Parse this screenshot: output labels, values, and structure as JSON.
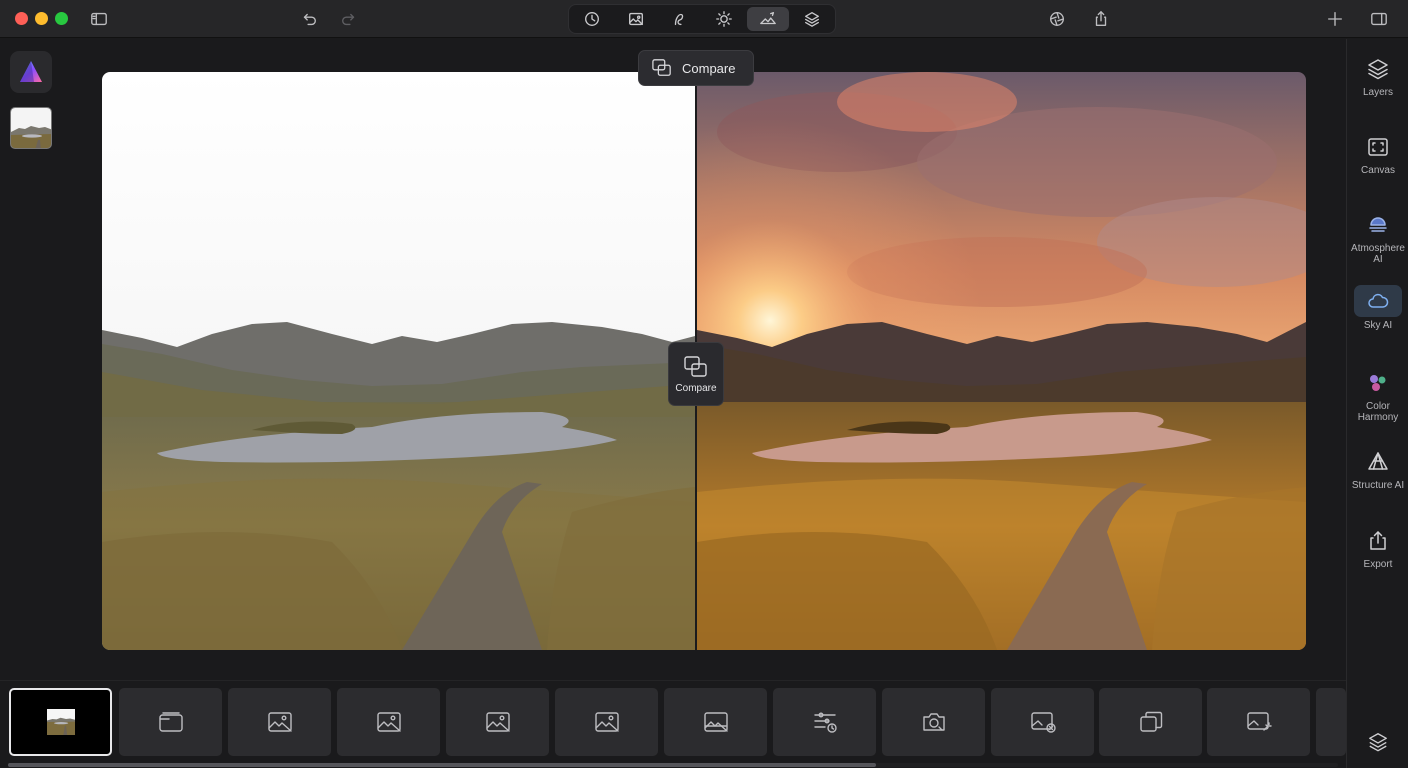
{
  "app": {
    "name": "Luminar Neo"
  },
  "toolbar": {
    "tools": [
      {
        "name": "history-tool",
        "active": false
      },
      {
        "name": "image-tool",
        "active": false
      },
      {
        "name": "curves-tool",
        "active": false
      },
      {
        "name": "light-tool",
        "active": false
      },
      {
        "name": "sky-tool",
        "active": true
      },
      {
        "name": "layers-tool",
        "active": false
      }
    ]
  },
  "canvas": {
    "compare_label": "Compare",
    "compare_tooltip": "Compare"
  },
  "right_panel": {
    "items": [
      {
        "label": "Layers",
        "icon": "layers-icon"
      },
      {
        "label": "Canvas",
        "icon": "canvas-icon"
      },
      {
        "label": "Atmosphere AI",
        "icon": "atmosphere-icon"
      },
      {
        "label": "Sky AI",
        "icon": "cloud-icon",
        "active": true
      },
      {
        "label": "Color Harmony",
        "icon": "color-harmony-icon"
      },
      {
        "label": "Structure AI",
        "icon": "structure-icon"
      },
      {
        "label": "Export",
        "icon": "export-icon"
      }
    ]
  },
  "filmstrip": {
    "items": [
      {
        "kind": "photo",
        "selected": true
      },
      {
        "kind": "template-icon"
      },
      {
        "kind": "image-icon"
      },
      {
        "kind": "image-icon"
      },
      {
        "kind": "image-icon"
      },
      {
        "kind": "image-icon"
      },
      {
        "kind": "image-icon"
      },
      {
        "kind": "adjust-icon"
      },
      {
        "kind": "camera-icon"
      },
      {
        "kind": "image-remove-icon"
      },
      {
        "kind": "duplicate-icon"
      },
      {
        "kind": "image-magic-icon"
      }
    ]
  },
  "colors": {
    "accent_active": "#2f3a48",
    "background": "#1a1a1c"
  }
}
